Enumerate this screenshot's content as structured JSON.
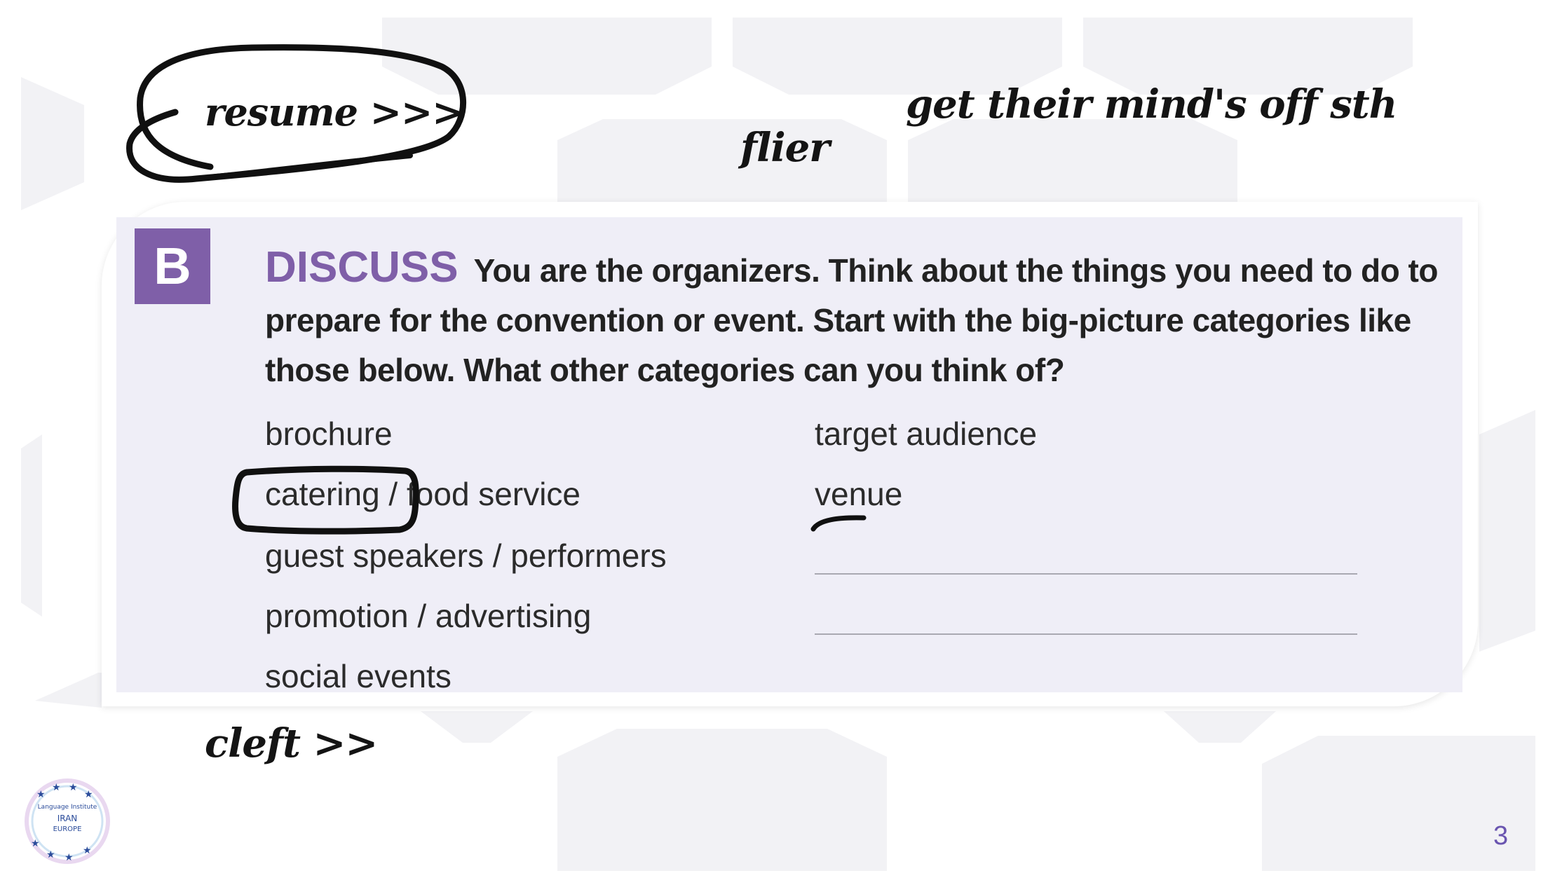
{
  "annotations": {
    "resume": "resume >>>",
    "flier": "flier",
    "mind": "get their mind's off sth",
    "cleft": "cleft >>"
  },
  "exercise": {
    "letter": "B",
    "heading": "DISCUSS",
    "prompt": "You are the organizers. Think about the things you need to do to prepare for the convention or event. Start with the big-picture categories like those below. What other categories can you think of?",
    "left_column": [
      "brochure",
      "catering / food service",
      "guest speakers / performers",
      "promotion / advertising",
      "social events"
    ],
    "right_column": [
      "target audience",
      "venue"
    ]
  },
  "logo": {
    "lines": [
      "Language Institute",
      "IRAN",
      "EUROPE"
    ],
    "icon": "star-circle-logo-icon"
  },
  "page_number": "3",
  "colors": {
    "accent_purple": "#7f5fa8",
    "exercise_background": "#efeef7",
    "page_number": "#6a55b0",
    "ink": "#141414",
    "pattern": "#f2f2f5"
  }
}
